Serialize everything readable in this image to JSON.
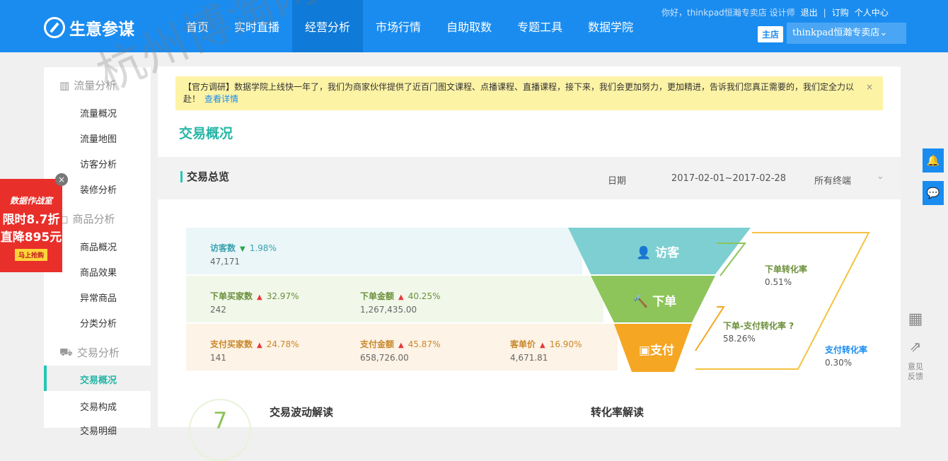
{
  "brand": {
    "name": "生意参谋"
  },
  "nav": [
    "首页",
    "实时直播",
    "经营分析",
    "市场行情",
    "自助取数",
    "专题工具",
    "数据学院"
  ],
  "toplinks": {
    "greeting": "你好，thinkpad恒瀚专卖店 设计师",
    "logout": "退出",
    "order": "订购",
    "center": "个人中心"
  },
  "store": {
    "badge": "主店",
    "name": "thinkpad恒瀚专卖店"
  },
  "sidebar": {
    "groups": [
      "流量分析",
      "商品分析",
      "交易分析"
    ],
    "traffic": [
      "流量概况",
      "流量地图",
      "访客分析",
      "装修分析"
    ],
    "product": [
      "商品概况",
      "商品效果",
      "异常商品",
      "分类分析"
    ],
    "trade": [
      "交易概况",
      "交易构成",
      "交易明细"
    ]
  },
  "notice": {
    "text": "【官方调研】数据学院上线快一年了，我们为商家伙伴提供了近百门图文课程、点播课程、直播课程，接下来，我们会更加努力，更加精进，告诉我们您真正需要的，我们定全力以赴！",
    "link": "查看详情",
    "close": "×"
  },
  "page": {
    "title": "交易概况"
  },
  "overview": {
    "title": "交易总览",
    "date_label": "日期",
    "date_range": "2017-02-01~2017-02-28",
    "terminal": "所有终端"
  },
  "metrics": {
    "visitors": {
      "name": "访客数",
      "pct": "1.98%",
      "value": "47,171",
      "dir": "down"
    },
    "order_buyers": {
      "name": "下单买家数",
      "pct": "32.97%",
      "value": "242",
      "dir": "up"
    },
    "order_amount": {
      "name": "下单金额",
      "pct": "40.25%",
      "value": "1,267,435.00",
      "dir": "up"
    },
    "pay_buyers": {
      "name": "支付买家数",
      "pct": "24.78%",
      "value": "141",
      "dir": "up"
    },
    "pay_amount": {
      "name": "支付金额",
      "pct": "45.87%",
      "value": "658,726.00",
      "dir": "up"
    },
    "unit_price": {
      "name": "客单价",
      "pct": "16.90%",
      "value": "4,671.81",
      "dir": "up"
    }
  },
  "funnel": {
    "visit": "访客",
    "order": "下单",
    "pay": "支付"
  },
  "rates": {
    "order_rate": {
      "name": "下单转化率",
      "value": "0.51%"
    },
    "order_pay_rate": {
      "name": "下单-支付转化率",
      "value": "58.26%"
    },
    "pay_rate": {
      "name": "支付转化率",
      "value": "0.30%"
    }
  },
  "bottom": {
    "score": "7",
    "left_title": "交易波动解读",
    "right_title": "转化率解读"
  },
  "ad": {
    "l1": "数据作战室",
    "l2": "限时8.7折",
    "l3": "直降895元",
    "l4": "马上抢购"
  },
  "tools": {
    "feedback": "意见反馈"
  },
  "watermark": "杭州博淘网络科技有限公司 http://hzzbutao.szfxbzs.com/",
  "colors": {
    "brand": "#1a8cf0",
    "accent": "#25c6b6",
    "visit": "#7dcfd2",
    "order": "#8dc55a",
    "pay": "#f5a623"
  }
}
